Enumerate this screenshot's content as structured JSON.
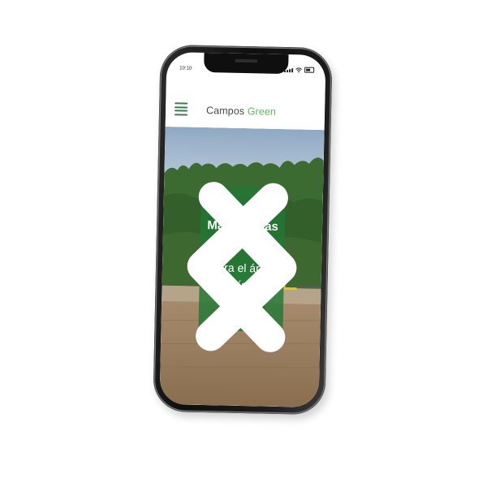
{
  "status_bar": {
    "time": "10:10",
    "icons": [
      "signal-icon",
      "wifi-icon",
      "battery-icon"
    ]
  },
  "header": {
    "brand_primary": "Campos",
    "brand_accent": "Green",
    "menu_icon": "hamburger-menu-icon"
  },
  "hero": {
    "title": "Maquinarias",
    "subtitle": "para el área agrícola",
    "prev_icon": "chevron-left-icon",
    "next_icon": "chevron-right-icon"
  },
  "colors": {
    "accent_green": "#5cb85c",
    "brand_text": "#3f4e44",
    "menu_green": "#3e7d52",
    "card_overlay": "#227834"
  }
}
